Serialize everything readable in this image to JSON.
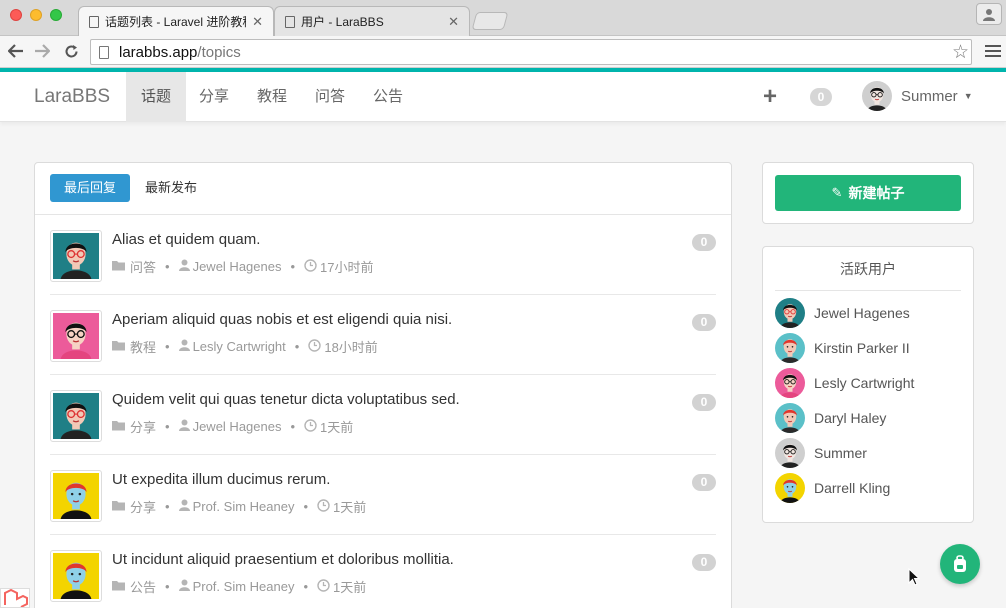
{
  "browser": {
    "tabs": [
      {
        "label": "话题列表 - Laravel 进阶教程",
        "close": "✕"
      },
      {
        "label": "用户 - LaraBBS",
        "close": "✕"
      }
    ],
    "url_host": "larabbs.app",
    "url_path": "/topics",
    "icons": {
      "back": "arrow-left",
      "forward": "arrow-right",
      "reload": "reload",
      "bookmark": "star-outline",
      "menu": "hamburger",
      "profile": "person"
    }
  },
  "navbar": {
    "brand": "LaraBBS",
    "items": [
      "话题",
      "分享",
      "教程",
      "问答",
      "公告"
    ],
    "active_item": "话题",
    "plus": "+",
    "notifications": "0",
    "user_name": "Summer",
    "caret": "▼",
    "accent_color": "#00b5ad"
  },
  "topics": {
    "tabs": [
      "最后回复",
      "最新发布"
    ],
    "active_tab": "最后回复",
    "sep": "•",
    "items": [
      {
        "title": "Alias et quidem quam.",
        "category": "问答",
        "author": "Jewel Hagenes",
        "time": "17小时前",
        "replies": "0",
        "avatar": "teal-man"
      },
      {
        "title": "Aperiam aliquid quas nobis et est eligendi quia nisi.",
        "category": "教程",
        "author": "Lesly Cartwright",
        "time": "18小时前",
        "replies": "0",
        "avatar": "pink-woman"
      },
      {
        "title": "Quidem velit qui quas tenetur dicta voluptatibus sed.",
        "category": "分享",
        "author": "Jewel Hagenes",
        "time": "1天前",
        "replies": "0",
        "avatar": "teal-man"
      },
      {
        "title": "Ut expedita illum ducimus rerum.",
        "category": "分享",
        "author": "Prof. Sim Heaney",
        "time": "1天前",
        "replies": "0",
        "avatar": "yellow-redhair"
      },
      {
        "title": "Ut incidunt aliquid praesentium et doloribus mollitia.",
        "category": "公告",
        "author": "Prof. Sim Heaney",
        "time": "1天前",
        "replies": "0",
        "avatar": "yellow-redhair"
      }
    ]
  },
  "sidebar": {
    "new_topic": "新建帖子",
    "new_topic_color": "#22b57a",
    "active_users_title": "活跃用户",
    "active_users": [
      {
        "name": "Jewel Hagenes",
        "avatar": "teal-man"
      },
      {
        "name": "Kirstin Parker II",
        "avatar": "cyan-redhair"
      },
      {
        "name": "Lesly Cartwright",
        "avatar": "pink-woman"
      },
      {
        "name": "Daryl Haley",
        "avatar": "cyan-redhair"
      },
      {
        "name": "Summer",
        "avatar": "grey-man"
      },
      {
        "name": "Darrell Kling",
        "avatar": "yellow-redhair"
      }
    ]
  }
}
